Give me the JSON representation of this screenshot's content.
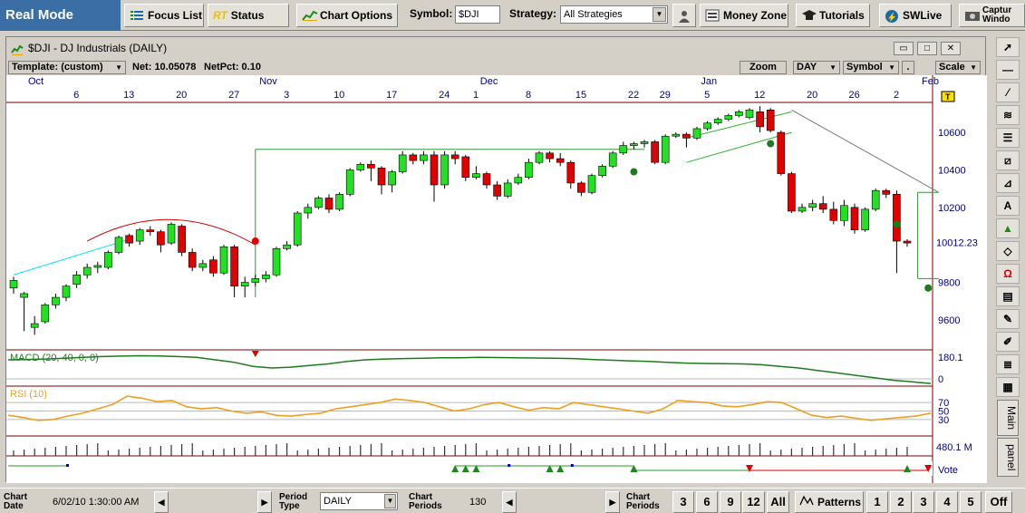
{
  "toolbar": {
    "mode": "Real Mode",
    "focus_list": "Focus List",
    "rt_prefix": "RT",
    "status": "Status",
    "chart_options": "Chart Options",
    "symbol_label": "Symbol:",
    "symbol_value": "$DJI",
    "strategy_label": "Strategy:",
    "strategy_value": "All Strategies",
    "money_zone": "Money Zone",
    "tutorials": "Tutorials",
    "swlive": "SWLive",
    "capture": "Captur Windo"
  },
  "window": {
    "title": "$DJI - DJ Industrials (DAILY)",
    "template": "Template: (custom)",
    "net": "Net: 10.05078",
    "netpct": "NetPct: 0.10",
    "zoom": "Zoom",
    "period": "DAY",
    "symbol_menu": "Symbol",
    "dot": ".",
    "scale": "Scale"
  },
  "chart_data": {
    "type": "candlestick",
    "months": [
      {
        "label": "Oct",
        "i": 0
      },
      {
        "label": "Nov",
        "i": 22
      },
      {
        "label": "Dec",
        "i": 43
      },
      {
        "label": "Jan",
        "i": 64
      },
      {
        "label": "Feb",
        "i": 85
      }
    ],
    "day_ticks": [
      {
        "label": "6",
        "i": 2
      },
      {
        "label": "13",
        "i": 7
      },
      {
        "label": "20",
        "i": 12
      },
      {
        "label": "27",
        "i": 17
      },
      {
        "label": "3",
        "i": 22
      },
      {
        "label": "10",
        "i": 27
      },
      {
        "label": "17",
        "i": 32
      },
      {
        "label": "24",
        "i": 37
      },
      {
        "label": "1",
        "i": 40
      },
      {
        "label": "8",
        "i": 45
      },
      {
        "label": "15",
        "i": 50
      },
      {
        "label": "22",
        "i": 55
      },
      {
        "label": "29",
        "i": 58
      },
      {
        "label": "5",
        "i": 62
      },
      {
        "label": "12",
        "i": 67
      },
      {
        "label": "20",
        "i": 72
      },
      {
        "label": "26",
        "i": 76
      },
      {
        "label": "2",
        "i": 80
      }
    ],
    "price_ticks": [
      10600,
      10400,
      10200,
      9800,
      9600
    ],
    "last_price": "10012.23",
    "ylim": [
      9440,
      10760
    ],
    "candles": [
      [
        9770,
        9810,
        9740,
        9830
      ],
      [
        9720,
        9740,
        9540,
        9750
      ],
      [
        9560,
        9580,
        9520,
        9620
      ],
      [
        9590,
        9680,
        9580,
        9690
      ],
      [
        9680,
        9720,
        9660,
        9740
      ],
      [
        9720,
        9780,
        9700,
        9790
      ],
      [
        9790,
        9840,
        9770,
        9860
      ],
      [
        9840,
        9880,
        9820,
        9900
      ],
      [
        9880,
        9890,
        9850,
        9910
      ],
      [
        9880,
        9960,
        9870,
        9970
      ],
      [
        9960,
        10040,
        9950,
        10050
      ],
      [
        10050,
        10010,
        9990,
        10060
      ],
      [
        10020,
        10080,
        10000,
        10090
      ],
      [
        10080,
        10070,
        10050,
        10100
      ],
      [
        10070,
        10000,
        9960,
        10080
      ],
      [
        10010,
        10110,
        10000,
        10120
      ],
      [
        10100,
        9960,
        9940,
        10110
      ],
      [
        9960,
        9880,
        9860,
        9980
      ],
      [
        9880,
        9900,
        9860,
        9920
      ],
      [
        9920,
        9850,
        9830,
        9940
      ],
      [
        9850,
        9990,
        9840,
        10000
      ],
      [
        9990,
        9780,
        9720,
        10000
      ],
      [
        9780,
        9800,
        9720,
        9830
      ],
      [
        9800,
        9820,
        9780,
        9840
      ],
      [
        9820,
        9840,
        9800,
        9860
      ],
      [
        9840,
        9980,
        9830,
        9990
      ],
      [
        9980,
        10000,
        9970,
        10020
      ],
      [
        10000,
        10170,
        9990,
        10180
      ],
      [
        10170,
        10200,
        10140,
        10220
      ],
      [
        10200,
        10250,
        10190,
        10260
      ],
      [
        10250,
        10190,
        10170,
        10270
      ],
      [
        10190,
        10270,
        10180,
        10280
      ],
      [
        10270,
        10400,
        10260,
        10410
      ],
      [
        10400,
        10430,
        10390,
        10440
      ],
      [
        10430,
        10410,
        10340,
        10450
      ],
      [
        10410,
        10320,
        10270,
        10420
      ],
      [
        10320,
        10390,
        10280,
        10400
      ],
      [
        10390,
        10480,
        10380,
        10500
      ],
      [
        10480,
        10450,
        10430,
        10490
      ],
      [
        10450,
        10480,
        10430,
        10500
      ],
      [
        10480,
        10320,
        10230,
        10500
      ],
      [
        10320,
        10480,
        10300,
        10500
      ],
      [
        10480,
        10460,
        10430,
        10500
      ],
      [
        10470,
        10360,
        10340,
        10480
      ],
      [
        10360,
        10380,
        10350,
        10420
      ],
      [
        10380,
        10320,
        10300,
        10390
      ],
      [
        10320,
        10260,
        10240,
        10340
      ],
      [
        10260,
        10330,
        10250,
        10350
      ],
      [
        10330,
        10360,
        10320,
        10380
      ],
      [
        10360,
        10440,
        10350,
        10460
      ],
      [
        10440,
        10490,
        10430,
        10500
      ],
      [
        10490,
        10460,
        10440,
        10500
      ],
      [
        10460,
        10440,
        10420,
        10490
      ],
      [
        10440,
        10330,
        10300,
        10450
      ],
      [
        10330,
        10280,
        10260,
        10340
      ],
      [
        10280,
        10370,
        10270,
        10380
      ],
      [
        10370,
        10420,
        10360,
        10430
      ],
      [
        10420,
        10490,
        10410,
        10500
      ],
      [
        10490,
        10530,
        10480,
        10550
      ],
      [
        10530,
        10540,
        10510,
        10550
      ],
      [
        10540,
        10550,
        10520,
        10560
      ],
      [
        10550,
        10440,
        10430,
        10560
      ],
      [
        10440,
        10580,
        10430,
        10590
      ],
      [
        10580,
        10590,
        10570,
        10600
      ],
      [
        10590,
        10570,
        10520,
        10600
      ],
      [
        10570,
        10620,
        10560,
        10630
      ],
      [
        10620,
        10650,
        10610,
        10660
      ],
      [
        10650,
        10670,
        10640,
        10680
      ],
      [
        10670,
        10690,
        10660,
        10700
      ],
      [
        10690,
        10710,
        10680,
        10720
      ],
      [
        10680,
        10720,
        10670,
        10730
      ],
      [
        10710,
        10630,
        10600,
        10740
      ],
      [
        10720,
        10610,
        10600,
        10730
      ],
      [
        10600,
        10380,
        10370,
        10610
      ],
      [
        10380,
        10180,
        10170,
        10390
      ],
      [
        10180,
        10200,
        10170,
        10220
      ],
      [
        10200,
        10220,
        10180,
        10240
      ],
      [
        10220,
        10190,
        10170,
        10260
      ],
      [
        10190,
        10130,
        10110,
        10230
      ],
      [
        10130,
        10210,
        10100,
        10240
      ],
      [
        10200,
        10080,
        10060,
        10220
      ],
      [
        10080,
        10190,
        10070,
        10200
      ],
      [
        10190,
        10290,
        10180,
        10300
      ],
      [
        10290,
        10270,
        10250,
        10300
      ],
      [
        10270,
        10020,
        9850,
        10290
      ],
      [
        10020,
        10010,
        9990,
        10030
      ]
    ],
    "overlay_lines": [
      {
        "x": [
          0,
          11
        ],
        "y": [
          9840,
          10030
        ],
        "color": "#00e5ff"
      },
      {
        "x": [
          64,
          74
        ],
        "y": [
          10570,
          10710
        ],
        "color": "#2db52d"
      },
      {
        "x": [
          64,
          74
        ],
        "y": [
          10440,
          10600
        ],
        "color": "#2db52d"
      },
      {
        "x": [
          74,
          88
        ],
        "y": [
          10720,
          10280
        ],
        "color": "#777777"
      },
      {
        "x": [
          23,
          23
        ],
        "y": [
          9720,
          10510
        ],
        "color": "#3a8f3a"
      },
      {
        "x": [
          23,
          60
        ],
        "y": [
          10510,
          10510
        ],
        "color": "#3a8f3a"
      },
      {
        "x": [
          86,
          86
        ],
        "y": [
          9820,
          10280
        ],
        "color": "#3a8f3a"
      },
      {
        "x": [
          86,
          88
        ],
        "y": [
          9820,
          9820
        ],
        "color": "#3a8f3a"
      },
      {
        "x": [
          86,
          88
        ],
        "y": [
          10280,
          10280
        ],
        "color": "#3a8f3a"
      }
    ],
    "markers": [
      {
        "i": 23,
        "y": 10020,
        "color": "#e00000"
      },
      {
        "i": 59,
        "y": 10390,
        "color": "#1d7b1d"
      },
      {
        "i": 72,
        "y": 10540,
        "color": "#1d7b1d"
      },
      {
        "i": 84,
        "y": 10110,
        "color": "#1d7b1d"
      },
      {
        "i": 87,
        "y": 9770,
        "color": "#1d7b1d"
      }
    ],
    "macd": {
      "label": "MACD (20, 40, 0, 0)",
      "tick_top": "180.1",
      "tick_zero": "0",
      "values": [
        150,
        152,
        155,
        160,
        165,
        170,
        173,
        175,
        174,
        170,
        165,
        150,
        135,
        110,
        100,
        105,
        115,
        125,
        140,
        150,
        155,
        158,
        160,
        162,
        163,
        165,
        164,
        163,
        161,
        160,
        158,
        152,
        148,
        144,
        140,
        135,
        130,
        128,
        126,
        125,
        120,
        110,
        100,
        85,
        70,
        55,
        40,
        25,
        15,
        5
      ]
    },
    "rsi": {
      "label": "RSI (10)",
      "levels": [
        "70",
        "50",
        "30"
      ],
      "values": [
        40,
        35,
        28,
        30,
        38,
        45,
        55,
        65,
        85,
        80,
        72,
        75,
        60,
        55,
        58,
        50,
        45,
        48,
        40,
        38,
        42,
        45,
        55,
        60,
        65,
        70,
        78,
        75,
        70,
        60,
        50,
        55,
        65,
        70,
        60,
        52,
        58,
        55,
        70,
        65,
        60,
        55,
        50,
        45,
        55,
        75,
        72,
        70,
        62,
        60,
        65,
        72,
        70,
        55,
        40,
        35,
        38,
        33,
        28,
        32,
        35,
        38,
        45
      ]
    },
    "volume": {
      "label": "480.1 M"
    },
    "vote": {
      "label": "Vote",
      "up_markers": [
        42,
        43,
        44,
        51,
        52,
        59,
        85
      ],
      "down_markers": [
        70,
        87
      ],
      "blue_markers": [
        5,
        47,
        53
      ]
    }
  },
  "right_toolbar": {
    "tab_main": "Main",
    "tab_panel": "panel"
  },
  "bottom": {
    "chart_date_label": "Chart Date",
    "chart_date_value": "6/02/10 1:30:00 AM",
    "period_type_label": "Period Type",
    "period_type_value": "DAILY",
    "chart_periods_label": "Chart Periods",
    "chart_periods_value": "130",
    "chart_periods_label2": "Chart Periods",
    "periods": [
      "3",
      "6",
      "9",
      "12",
      "All"
    ],
    "patterns": "Patterns",
    "pattern_nums": [
      "1",
      "2",
      "3",
      "4",
      "5"
    ],
    "off": "Off"
  },
  "colors": {
    "up": "#22e022",
    "down": "#e00000",
    "title_bg": "#3a6ea5",
    "macd": "#1f7a1f",
    "rsi": "#f0a020"
  }
}
